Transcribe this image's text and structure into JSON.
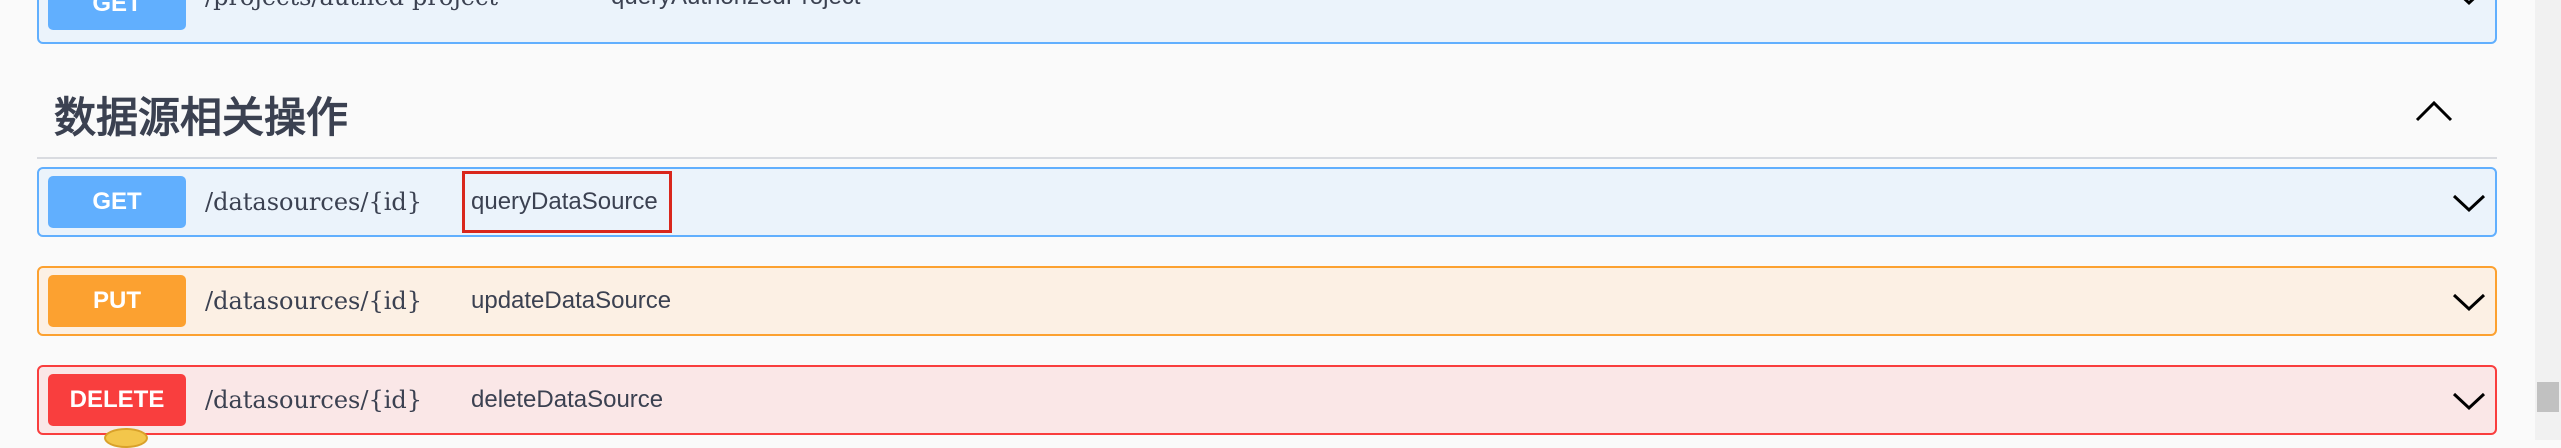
{
  "sections": {
    "previous_op": {
      "method": "GET",
      "path": "/projects/authed-project",
      "summary": "queryAuthorizedProject"
    },
    "datasource": {
      "title": "数据源相关操作",
      "operations": [
        {
          "method": "GET",
          "path": "/datasources/{id}",
          "summary": "queryDataSource",
          "highlighted": true
        },
        {
          "method": "PUT",
          "path": "/datasources/{id}",
          "summary": "updateDataSource"
        },
        {
          "method": "DELETE",
          "path": "/datasources/{id}",
          "summary": "deleteDataSource"
        }
      ]
    }
  },
  "icons": {
    "expand": "chevron-down-icon",
    "collapse": "chevron-up-icon"
  },
  "colors": {
    "get": "#61affe",
    "put": "#fca130",
    "delete": "#f93e3e",
    "highlight": "#d9261c"
  }
}
